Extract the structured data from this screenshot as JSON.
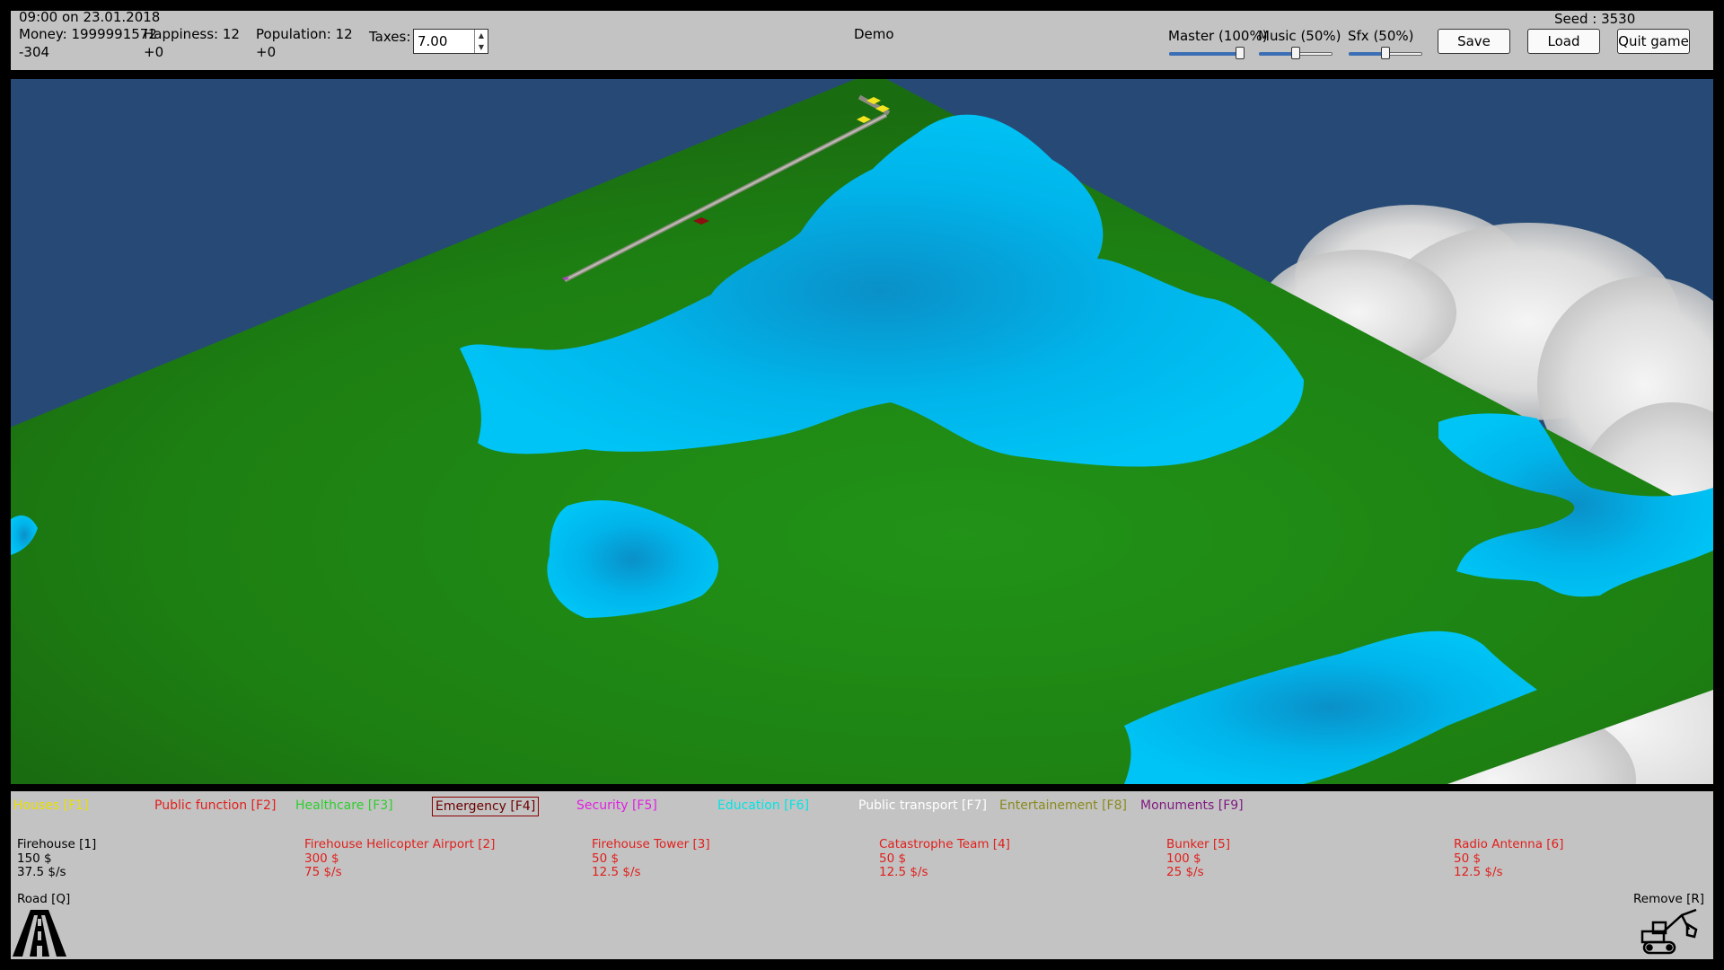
{
  "stats": {
    "datetime": "09:00 on 23.01.2018",
    "money": "Money: 1999991572",
    "money_delta": "-304",
    "happiness": "Happiness: 12",
    "happiness_delta": "+0",
    "population": "Population: 12",
    "population_delta": "+0",
    "taxes_label": "Taxes:",
    "taxes_value": "7.00"
  },
  "title": "Demo",
  "seed": "Seed : 3530",
  "volume": {
    "master": {
      "label": "Master (100%)",
      "value": 1.0
    },
    "music": {
      "label": "Music (50%)",
      "value": 0.5
    },
    "sfx": {
      "label": "Sfx (50%)",
      "value": 0.5
    }
  },
  "buttons": {
    "save": "Save",
    "load": "Load",
    "quit": "Quit game"
  },
  "categories": [
    {
      "label": "Houses [F1]",
      "color": "#e8e000"
    },
    {
      "label": "Public function [F2]",
      "color": "#e0201c"
    },
    {
      "label": "Healthcare [F3]",
      "color": "#2fce2f"
    },
    {
      "label": "Emergency [F4]",
      "color": "#6b0000",
      "active": true
    },
    {
      "label": "Security [F5]",
      "color": "#e020e0"
    },
    {
      "label": "Education [F6]",
      "color": "#00e5e5"
    },
    {
      "label": "Public transport [F7]",
      "color": "#ffffff"
    },
    {
      "label": "Entertainement [F8]",
      "color": "#8a8a20"
    },
    {
      "label": "Monuments [F9]",
      "color": "#801a80"
    }
  ],
  "buildings": [
    {
      "name": "Firehouse [1]",
      "cost": "150 $",
      "upkeep": "37.5 $/s",
      "affordable": true
    },
    {
      "name": "Firehouse Helicopter Airport [2]",
      "cost": "300 $",
      "upkeep": "75 $/s",
      "affordable": false
    },
    {
      "name": "Firehouse Tower [3]",
      "cost": "50 $",
      "upkeep": "12.5 $/s",
      "affordable": false
    },
    {
      "name": "Catastrophe Team [4]",
      "cost": "50 $",
      "upkeep": "12.5 $/s",
      "affordable": false
    },
    {
      "name": "Bunker [5]",
      "cost": "100 $",
      "upkeep": "25 $/s",
      "affordable": false
    },
    {
      "name": "Radio Antenna [6]",
      "cost": "50 $",
      "upkeep": "12.5 $/s",
      "affordable": false
    }
  ],
  "tools": {
    "road": "Road [Q]",
    "remove": "Remove [R]"
  },
  "colors": {
    "ui_bg": "#c3c3c3",
    "sky": "#264a75",
    "grass": "#1f8a14",
    "water": "#00c0f2",
    "building_unaffordable": "#e0201c"
  }
}
